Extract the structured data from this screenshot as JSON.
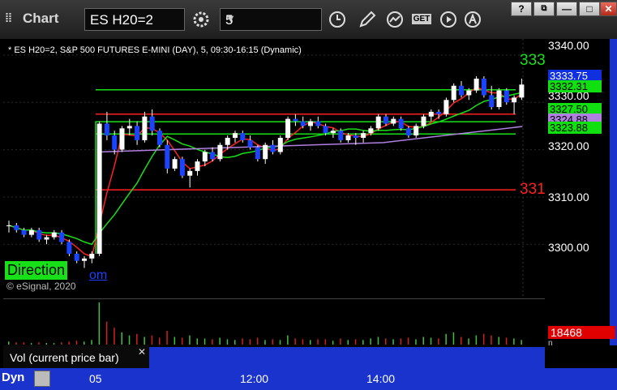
{
  "window": {
    "app_title": "Chart",
    "app_icon": "dots-grip-icon"
  },
  "toolbar": {
    "symbol": "ES H20=2",
    "interval": "5",
    "buttons": [
      "settings-gear-icon",
      "clock-icon",
      "pencil-icon",
      "studies-icon",
      "get-icon",
      "play-icon",
      "alert-icon"
    ],
    "get_text": "GET"
  },
  "window_controls": {
    "help": "?",
    "restore": "⧉",
    "minimize": "—",
    "maximize": "□",
    "close": "✕"
  },
  "chart": {
    "info": "* ES H20=2, S&P 500 FUTURES E-MINI (DAY), 5, 09:30-16:15 (Dynamic)",
    "direction_label": "Direction",
    "direction_link": "om",
    "copyright": "© eSignal, 2020",
    "level_top": "333",
    "level_bottom": "331",
    "axis_labels": [
      "3340.00",
      "3330.00",
      "3320.00",
      "3310.00",
      "3300.00"
    ],
    "tags": {
      "last": "3333.75",
      "a": "3332.31",
      "b": "3327.50",
      "c": "3324.88",
      "d": "3323.88"
    }
  },
  "volume": {
    "label": "Vol (current price bar)",
    "close": "✕",
    "value": "18468",
    "n": "n"
  },
  "time_axis": {
    "dyn": "Dyn",
    "labels": [
      "05",
      "12:00",
      "14:00"
    ]
  },
  "chart_data": {
    "type": "candlestick",
    "ylim": [
      3292,
      3341
    ],
    "levels": [
      3333.0,
      3311.5
    ],
    "resistance_red": 3327.5,
    "candles": [
      [
        3304.0,
        3305.0,
        3302.5,
        3304.0
      ],
      [
        3304.0,
        3304.5,
        3302.5,
        3303.0
      ],
      [
        3303.0,
        3303.5,
        3301.5,
        3302.0
      ],
      [
        3302.0,
        3303.5,
        3301.5,
        3303.0
      ],
      [
        3303.0,
        3303.5,
        3300.5,
        3301.0
      ],
      [
        3301.0,
        3302.0,
        3300.0,
        3301.5
      ],
      [
        3301.5,
        3303.0,
        3301.0,
        3302.5
      ],
      [
        3302.5,
        3303.0,
        3300.0,
        3300.5
      ],
      [
        3300.5,
        3301.0,
        3297.5,
        3298.0
      ],
      [
        3298.0,
        3298.5,
        3296.0,
        3296.5
      ],
      [
        3296.5,
        3297.5,
        3295.0,
        3297.0
      ],
      [
        3297.0,
        3298.5,
        3296.0,
        3298.0
      ],
      [
        3298.0,
        3326.0,
        3297.5,
        3325.5
      ],
      [
        3325.5,
        3328.0,
        3322.0,
        3323.0
      ],
      [
        3323.0,
        3324.0,
        3319.0,
        3320.0
      ],
      [
        3320.0,
        3325.0,
        3319.5,
        3324.5
      ],
      [
        3324.5,
        3326.5,
        3323.0,
        3325.0
      ],
      [
        3325.0,
        3326.0,
        3321.0,
        3322.0
      ],
      [
        3322.0,
        3328.0,
        3321.5,
        3327.0
      ],
      [
        3327.0,
        3328.5,
        3323.0,
        3324.0
      ],
      [
        3324.0,
        3324.5,
        3320.5,
        3321.0
      ],
      [
        3321.0,
        3322.0,
        3315.0,
        3316.0
      ],
      [
        3316.0,
        3318.5,
        3315.5,
        3318.0
      ],
      [
        3318.0,
        3318.5,
        3314.0,
        3314.5
      ],
      [
        3314.5,
        3316.0,
        3312.0,
        3315.5
      ],
      [
        3315.5,
        3318.0,
        3314.5,
        3317.5
      ],
      [
        3317.5,
        3320.0,
        3316.5,
        3319.5
      ],
      [
        3319.5,
        3320.5,
        3317.5,
        3318.0
      ],
      [
        3318.0,
        3321.5,
        3317.5,
        3321.0
      ],
      [
        3321.0,
        3323.0,
        3320.0,
        3322.5
      ],
      [
        3322.5,
        3324.0,
        3321.5,
        3323.5
      ],
      [
        3323.5,
        3324.0,
        3321.5,
        3322.0
      ],
      [
        3322.0,
        3323.0,
        3320.0,
        3320.5
      ],
      [
        3320.5,
        3321.0,
        3317.5,
        3318.0
      ],
      [
        3318.0,
        3321.5,
        3317.0,
        3321.0
      ],
      [
        3321.0,
        3322.0,
        3319.0,
        3319.5
      ],
      [
        3319.5,
        3323.0,
        3319.0,
        3322.5
      ],
      [
        3322.5,
        3327.0,
        3322.0,
        3326.5
      ],
      [
        3326.5,
        3327.5,
        3325.0,
        3326.0
      ],
      [
        3326.0,
        3327.0,
        3324.5,
        3325.0
      ],
      [
        3325.0,
        3326.5,
        3324.0,
        3326.0
      ],
      [
        3326.0,
        3327.0,
        3324.5,
        3325.0
      ],
      [
        3325.0,
        3325.5,
        3323.0,
        3323.5
      ],
      [
        3323.5,
        3324.5,
        3322.5,
        3324.0
      ],
      [
        3324.0,
        3324.5,
        3321.5,
        3322.0
      ],
      [
        3322.0,
        3323.5,
        3321.5,
        3323.0
      ],
      [
        3323.0,
        3323.5,
        3321.0,
        3322.5
      ],
      [
        3322.5,
        3324.0,
        3321.5,
        3323.5
      ],
      [
        3323.5,
        3325.0,
        3323.0,
        3324.5
      ],
      [
        3324.5,
        3327.5,
        3324.0,
        3327.0
      ],
      [
        3327.0,
        3327.5,
        3325.0,
        3325.5
      ],
      [
        3325.5,
        3327.0,
        3325.0,
        3326.5
      ],
      [
        3326.5,
        3327.0,
        3324.0,
        3324.5
      ],
      [
        3324.5,
        3325.0,
        3322.5,
        3323.0
      ],
      [
        3323.0,
        3325.5,
        3322.5,
        3325.0
      ],
      [
        3325.0,
        3327.5,
        3324.5,
        3327.0
      ],
      [
        3327.0,
        3328.5,
        3326.0,
        3328.0
      ],
      [
        3328.0,
        3328.5,
        3326.5,
        3327.5
      ],
      [
        3327.5,
        3331.0,
        3327.0,
        3330.5
      ],
      [
        3330.5,
        3334.0,
        3330.0,
        3333.5
      ],
      [
        3333.5,
        3334.5,
        3331.0,
        3331.5
      ],
      [
        3331.5,
        3333.0,
        3330.5,
        3332.5
      ],
      [
        3332.5,
        3335.5,
        3332.0,
        3335.0
      ],
      [
        3335.0,
        3335.5,
        3331.0,
        3331.5
      ],
      [
        3331.5,
        3333.5,
        3328.5,
        3329.0
      ],
      [
        3329.0,
        3333.0,
        3328.5,
        3332.5
      ],
      [
        3332.5,
        3333.0,
        3329.5,
        3330.0
      ],
      [
        3330.0,
        3331.5,
        3327.5,
        3331.0
      ],
      [
        3331.0,
        3335.0,
        3330.5,
        3333.75
      ]
    ],
    "volume": [
      4,
      3,
      3,
      2,
      3,
      2,
      2,
      3,
      4,
      5,
      4,
      6,
      55,
      30,
      22,
      16,
      12,
      14,
      10,
      12,
      9,
      18,
      10,
      9,
      12,
      8,
      8,
      7,
      9,
      7,
      6,
      8,
      7,
      9,
      6,
      7,
      6,
      12,
      8,
      7,
      6,
      7,
      7,
      5,
      8,
      6,
      7,
      6,
      8,
      10,
      8,
      7,
      8,
      9,
      7,
      10,
      9,
      8,
      14,
      16,
      10,
      8,
      12,
      14,
      12,
      10,
      9,
      8,
      6
    ]
  }
}
